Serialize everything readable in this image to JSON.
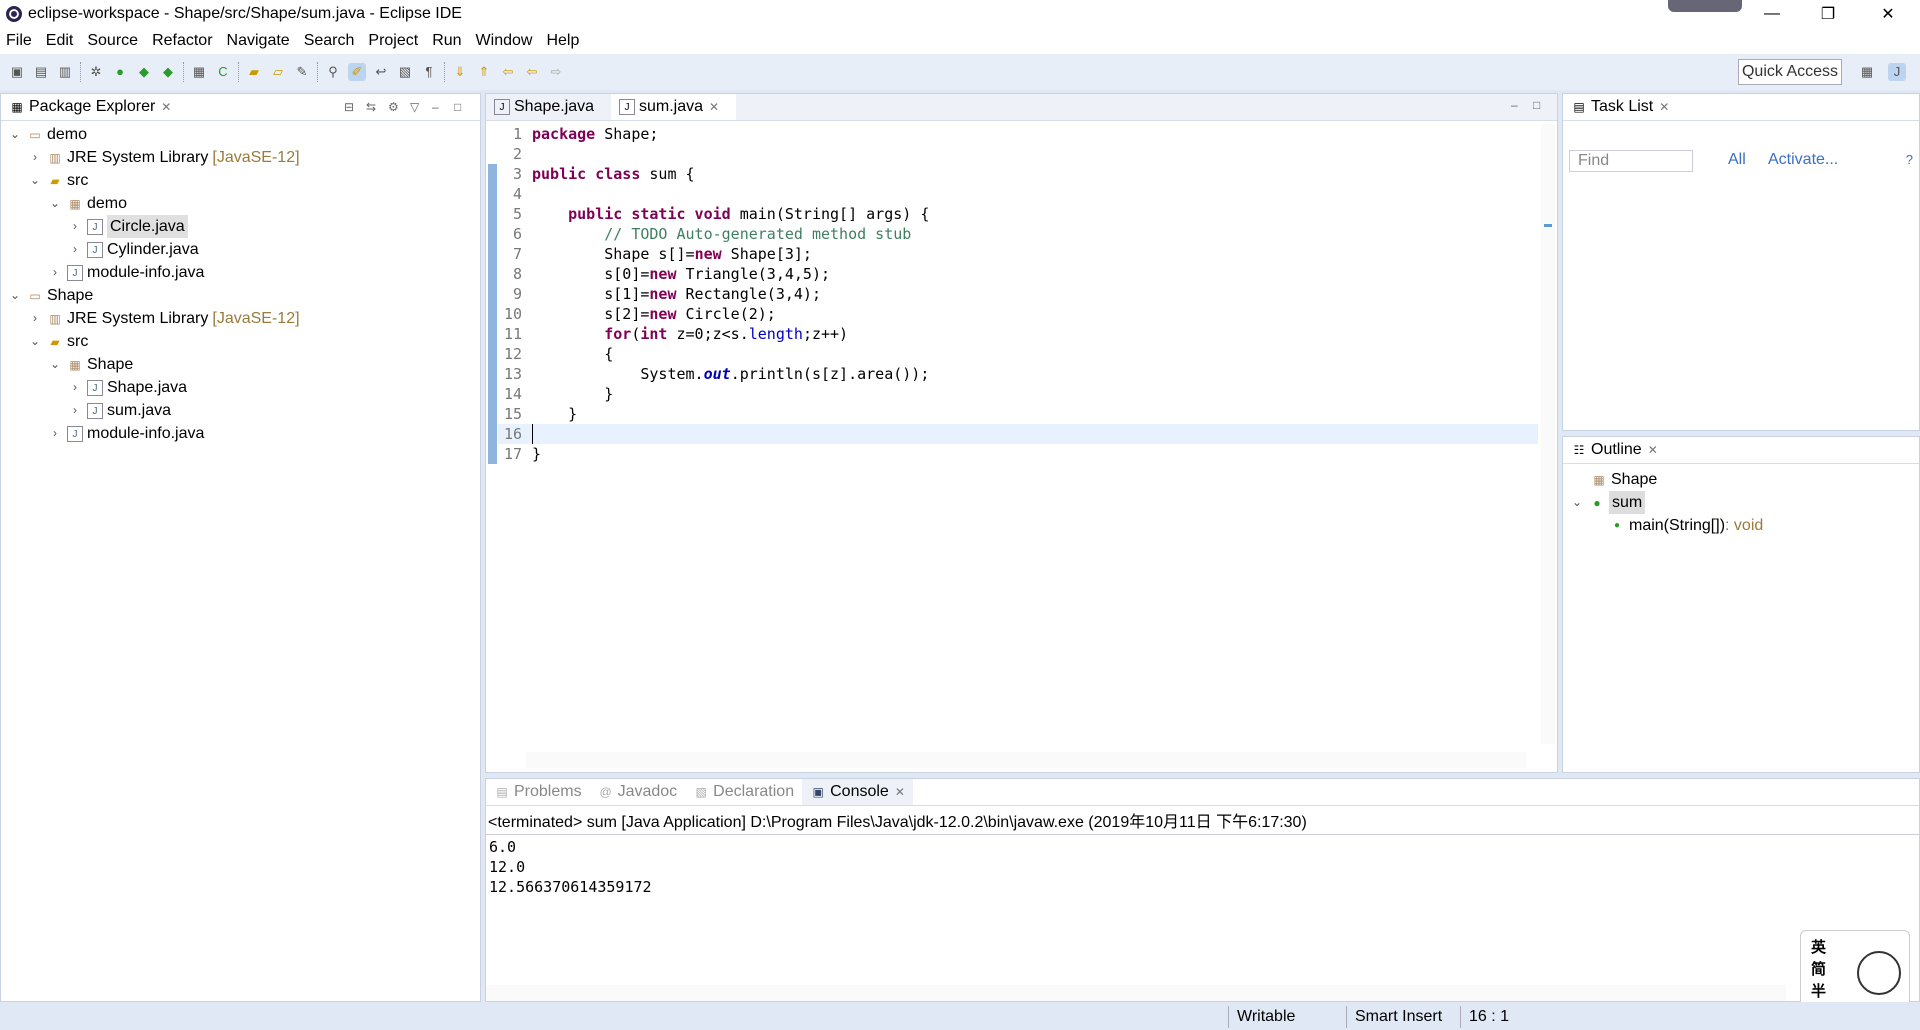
{
  "window": {
    "title": "eclipse-workspace - Shape/src/Shape/sum.java - Eclipse IDE",
    "minimize": "—",
    "restore": "❐",
    "close": "✕"
  },
  "menu": [
    "File",
    "Edit",
    "Source",
    "Refactor",
    "Navigate",
    "Search",
    "Project",
    "Run",
    "Window",
    "Help"
  ],
  "toolbar": {
    "quick_access": "Quick Access"
  },
  "package_explorer": {
    "title": "Package Explorer",
    "items": [
      {
        "depth": 0,
        "arrow": "v",
        "icon": "project",
        "label": "demo"
      },
      {
        "depth": 1,
        "arrow": ">",
        "icon": "library",
        "label": "JRE System Library",
        "suffix": "[JavaSE-12]"
      },
      {
        "depth": 1,
        "arrow": "v",
        "icon": "folder",
        "label": "src"
      },
      {
        "depth": 2,
        "arrow": "v",
        "icon": "package",
        "label": "demo"
      },
      {
        "depth": 3,
        "arrow": ">",
        "icon": "java-file",
        "label": "Circle.java",
        "selected": true
      },
      {
        "depth": 3,
        "arrow": ">",
        "icon": "java-file",
        "label": "Cylinder.java"
      },
      {
        "depth": 2,
        "arrow": ">",
        "icon": "java-file",
        "label": "module-info.java"
      },
      {
        "depth": 0,
        "arrow": "v",
        "icon": "project",
        "label": "Shape"
      },
      {
        "depth": 1,
        "arrow": ">",
        "icon": "library",
        "label": "JRE System Library",
        "suffix": "[JavaSE-12]"
      },
      {
        "depth": 1,
        "arrow": "v",
        "icon": "folder",
        "label": "src"
      },
      {
        "depth": 2,
        "arrow": "v",
        "icon": "package",
        "label": "Shape"
      },
      {
        "depth": 3,
        "arrow": ">",
        "icon": "java-file",
        "label": "Shape.java"
      },
      {
        "depth": 3,
        "arrow": ">",
        "icon": "java-file",
        "label": "sum.java"
      },
      {
        "depth": 2,
        "arrow": ">",
        "icon": "java-file",
        "label": "module-info.java"
      }
    ]
  },
  "editor": {
    "tabs": [
      {
        "label": "Shape.java",
        "active": false
      },
      {
        "label": "sum.java",
        "active": true
      }
    ],
    "lines": [
      "<span class=\"kw\">package</span> Shape;",
      "",
      "<span class=\"kw\">public class</span> sum {",
      "",
      "    <span class=\"kw\">public static void</span> main(String[] args) {",
      "        <span class=\"cm\">// TODO Auto-generated method stub</span>",
      "        Shape s[]=<span class=\"kw\">new</span> Shape[3];",
      "        s[0]=<span class=\"kw\">new</span> Triangle(3,4,5);",
      "        s[1]=<span class=\"kw\">new</span> Rectangle(3,4);",
      "        s[2]=<span class=\"kw\">new</span> Circle(2);",
      "        <span class=\"kw\">for</span>(<span class=\"kw\">int</span> z=0;z&lt;s.<span class=\"fld\">length</span>;z++)",
      "        {",
      "            System.<span class=\"st\">out</span>.println(s[z].area());",
      "        }",
      "    }",
      "",
      "}"
    ],
    "current_line": 16
  },
  "task_list": {
    "title": "Task List",
    "find_placeholder": "Find",
    "all": "All",
    "activate": "Activate..."
  },
  "outline": {
    "title": "Outline",
    "items": [
      {
        "label": "Shape",
        "icon": "package"
      },
      {
        "label": "sum",
        "icon": "class"
      },
      {
        "label": "main(String[])",
        "type": " : void",
        "icon": "method"
      }
    ]
  },
  "console": {
    "tabs": [
      "Problems",
      "Javadoc",
      "Declaration",
      "Console"
    ],
    "active": "Console",
    "header": "<terminated> sum [Java Application] D:\\Program Files\\Java\\jdk-12.0.2\\bin\\javaw.exe (2019年10月11日 下午6:17:30)",
    "output": [
      "6.0",
      "12.0",
      "12.566370614359172"
    ]
  },
  "status": {
    "writable": "Writable",
    "insert": "Smart Insert",
    "position": "16 : 1"
  },
  "ime": {
    "chars": [
      "英",
      "简",
      "半",
      "♥"
    ]
  }
}
